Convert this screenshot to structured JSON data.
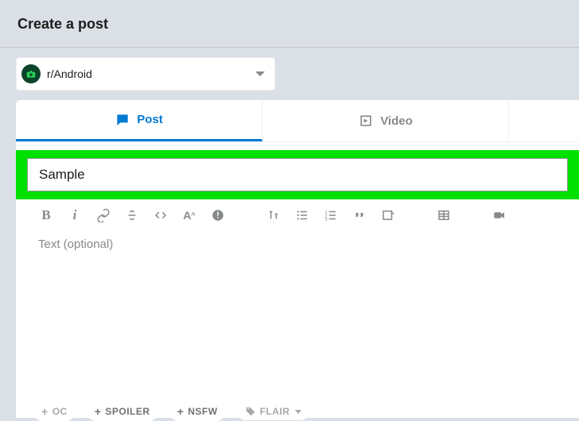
{
  "header": {
    "title": "Create a post"
  },
  "community": {
    "name": "r/Android"
  },
  "tabs": {
    "post": "Post",
    "video": "Video"
  },
  "form": {
    "title_value": "Sample",
    "body_placeholder": "Text (optional)"
  },
  "tags": {
    "oc": "OC",
    "spoiler": "SPOILER",
    "nsfw": "NSFW",
    "flair": "FLAIR"
  }
}
